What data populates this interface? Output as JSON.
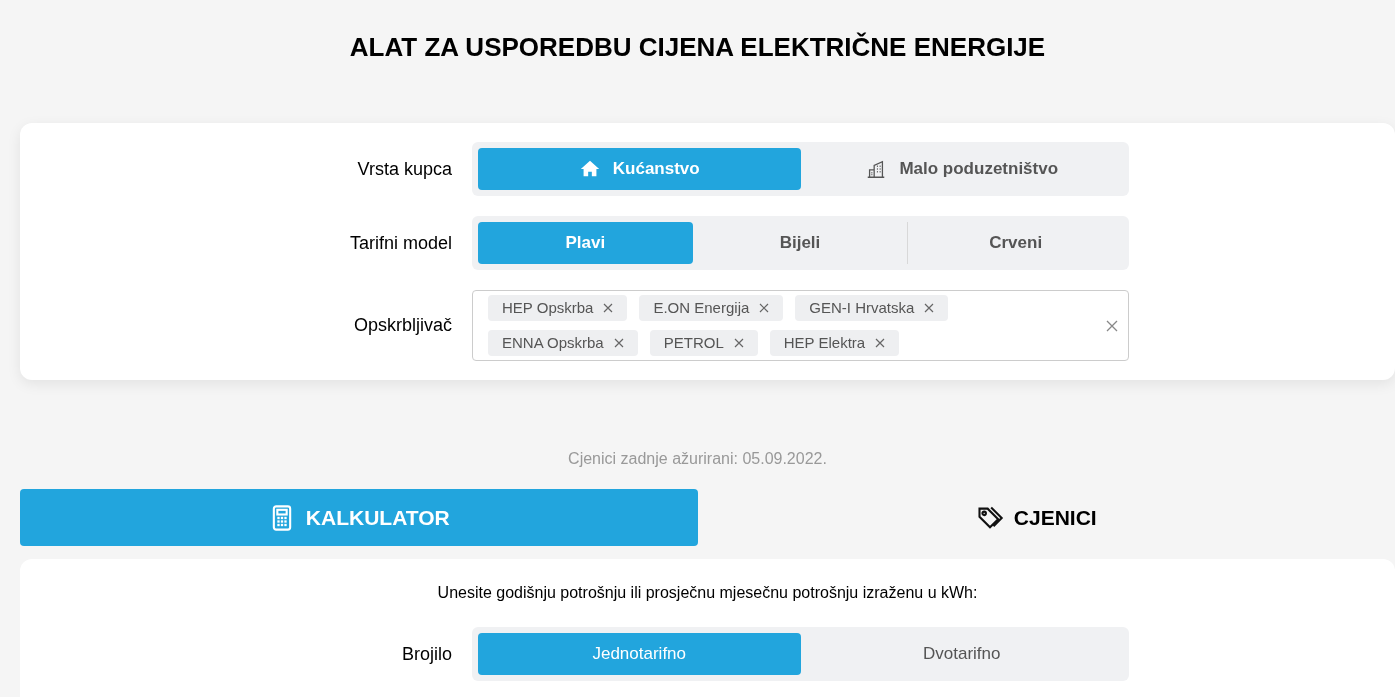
{
  "title": "ALAT ZA USPOREDBU CIJENA ELEKTRIČNE ENERGIJE",
  "filters": [
    {
      "label": "Vrsta kupca",
      "kind": "segmented",
      "options": [
        {
          "label": "Kućanstvo",
          "kind": "house",
          "selected": true
        },
        {
          "label": "Malo poduzetništvo",
          "kind": "building",
          "selected": false
        }
      ]
    },
    {
      "label": "Tarifni model",
      "kind": "segmented",
      "options": [
        {
          "label": "Plavi",
          "selected": true
        },
        {
          "label": "Bijeli",
          "selected": false
        },
        {
          "label": "Crveni",
          "selected": false
        }
      ]
    },
    {
      "label": "Opskrbljivač",
      "kind": "multiselect",
      "tags": [
        "HEP Opskrba",
        "E.ON Energija",
        "GEN-I Hrvatska",
        "ENNA Opskrba",
        "PETROL",
        "HEP Elektra"
      ]
    }
  ],
  "updated": "Cjenici zadnje ažurirani: 05.09.2022.",
  "main_tabs": [
    {
      "label": "KALKULATOR",
      "kind": "calculator",
      "selected": true
    },
    {
      "label": "CJENICI",
      "kind": "tag",
      "selected": false
    }
  ],
  "calculator": {
    "instruction": "Unesite godišnju potrošnju ili prosječnu mjesečnu potrošnju izraženu u kWh:",
    "meter": {
      "label": "Brojilo",
      "options": [
        {
          "label": "Jednotarifno",
          "selected": true
        },
        {
          "label": "Dvotarifno",
          "selected": false
        }
      ]
    }
  }
}
